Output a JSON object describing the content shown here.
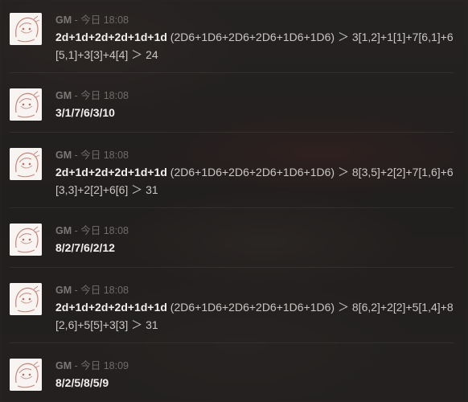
{
  "messages": [
    {
      "name": "GM",
      "sep": " - ",
      "time": "今日 18:08",
      "formula": "2d+1d+2d+2d+1d+1d",
      "detail": " (2D6+1D6+2D6+2D6+1D6+1D6)",
      "result": " ＞ 3[1,2]+1[1]+7[6,1]+6[5,1]+3[3]+4[4] ＞ 24"
    },
    {
      "name": "GM",
      "sep": " - ",
      "time": "今日 18:08",
      "formula": "3/1/7/6/3/10",
      "detail": "",
      "result": ""
    },
    {
      "name": "GM",
      "sep": " - ",
      "time": "今日 18:08",
      "formula": "2d+1d+2d+2d+1d+1d",
      "detail": " (2D6+1D6+2D6+2D6+1D6+1D6)",
      "result": " ＞ 8[3,5]+2[2]+7[1,6]+6[3,3]+2[2]+6[6] ＞ 31"
    },
    {
      "name": "GM",
      "sep": " - ",
      "time": "今日 18:08",
      "formula": "8/2/7/6/2/12",
      "detail": "",
      "result": ""
    },
    {
      "name": "GM",
      "sep": " - ",
      "time": "今日 18:08",
      "formula": "2d+1d+2d+2d+1d+1d",
      "detail": " (2D6+1D6+2D6+2D6+1D6+1D6)",
      "result": " ＞ 8[6,2]+2[2]+5[1,4]+8[2,6]+5[5]+3[3] ＞ 31"
    },
    {
      "name": "GM",
      "sep": " - ",
      "time": "今日 18:09",
      "formula": "8/2/5/8/5/9",
      "detail": "",
      "result": ""
    }
  ]
}
